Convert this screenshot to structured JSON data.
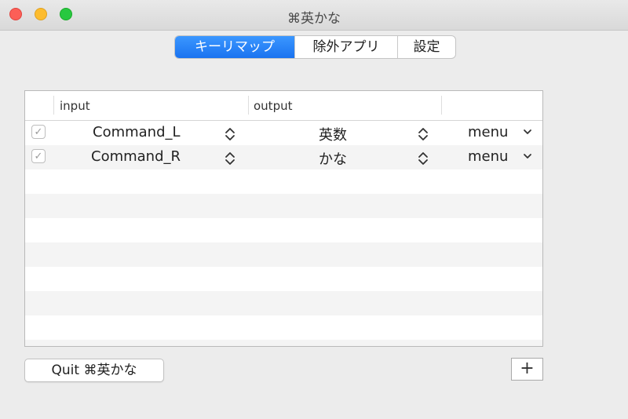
{
  "window": {
    "title": "⌘英かな"
  },
  "tabs": [
    {
      "label": "キーリマップ",
      "active": true
    },
    {
      "label": "除外アプリ",
      "active": false
    },
    {
      "label": "設定",
      "active": false
    }
  ],
  "table": {
    "columns": [
      "input",
      "output",
      ""
    ],
    "rows": [
      {
        "checked": true,
        "input": "Command_L",
        "output": "英数",
        "action": "menu"
      },
      {
        "checked": true,
        "input": "Command_R",
        "output": "かな",
        "action": "menu"
      }
    ]
  },
  "footer": {
    "quit_label": "Quit ⌘英かな",
    "add_label": "+"
  },
  "colors": {
    "accent": "#1a73f0",
    "close": "#fc5f57",
    "minimize": "#fdbc2e",
    "zoom": "#28c840"
  },
  "icons": {
    "check": "✓"
  }
}
